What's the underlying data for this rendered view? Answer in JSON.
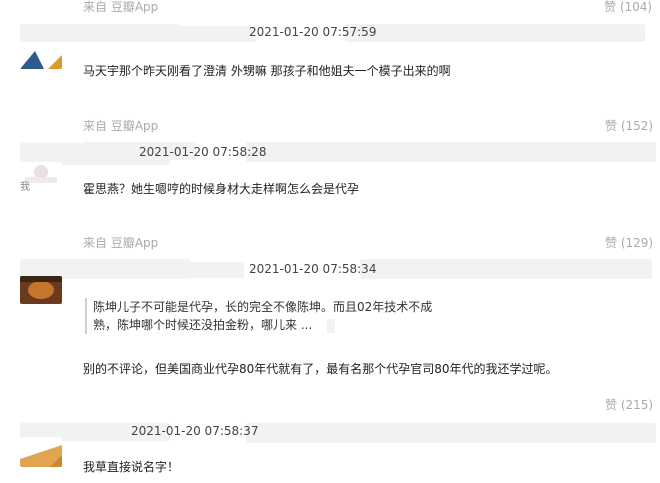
{
  "comments": [
    {
      "timestamp": "2021-01-20 07:57:59",
      "text": "马天宇那个昨天刚看了澄清 外甥嘛 那孩子和他姐夫一个模子出来的啊",
      "source": "来自 豆瓣App",
      "likes": "赞 (152)"
    },
    {
      "timestamp": "2021-01-20 07:58:28",
      "text": "霍思燕？她生嗯哼的时候身材大走样啊怎么会是代孕",
      "source": "来自 豆瓣App",
      "likes": "赞 (129)"
    },
    {
      "timestamp": "2021-01-20 07:58:34",
      "quote_line1": "陈坤儿子不可能是代孕，长的完全不像陈坤。而且02年技术不成",
      "quote_line2": "熟，陈坤哪个时候还没拍金粉，哪儿来 ...",
      "text": "别的不评论，但美国商业代孕80年代就有了，最有名那个代孕官司80年代的我还学过呢。",
      "likes": "赞 (215)"
    },
    {
      "timestamp": "2021-01-20 07:58:37",
      "text": "我草直接说名字！"
    }
  ],
  "top": {
    "source": "来自 豆瓣App",
    "likes": "赞 (104)"
  },
  "avatar_labels": {
    "second": "我"
  }
}
